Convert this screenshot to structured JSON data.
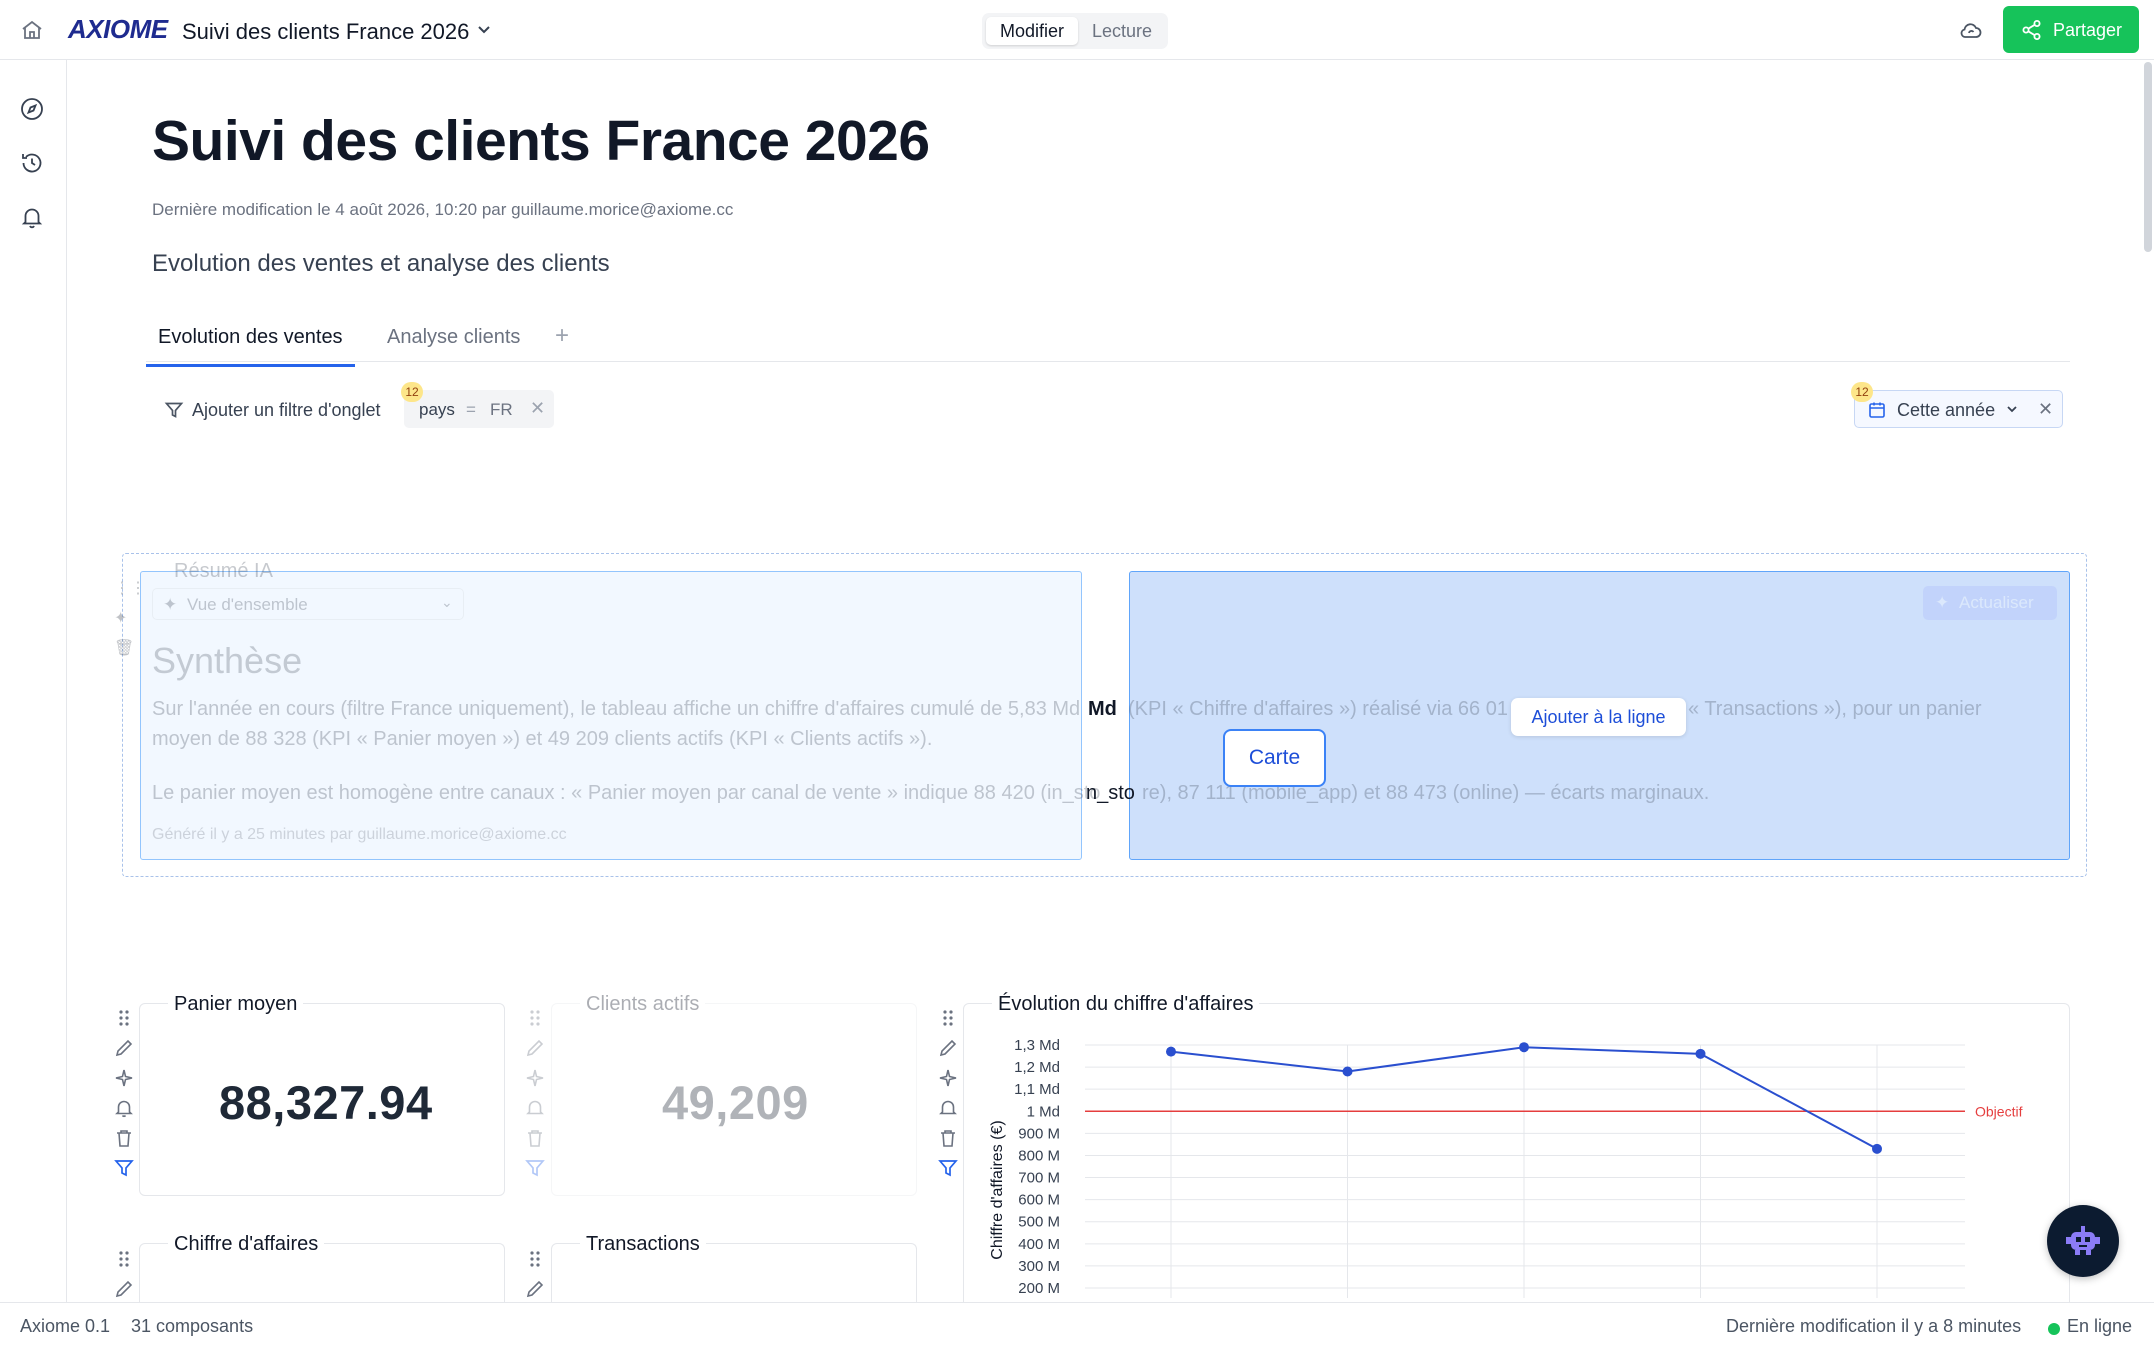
{
  "topbar": {
    "logo": "AXIOME",
    "document_title": "Suivi des clients France 2026",
    "mode_edit": "Modifier",
    "mode_read": "Lecture",
    "share_label": "Partager"
  },
  "page": {
    "title": "Suivi des clients France 2026",
    "meta": "Dernière modification le 4 août 2026, 10:20 par guillaume.morice@axiome.cc",
    "subtitle": "Evolution des ventes et analyse des clients"
  },
  "tabs": [
    {
      "label": "Evolution des ventes",
      "active": true
    },
    {
      "label": "Analyse clients",
      "active": false
    }
  ],
  "tab_add": "+",
  "filters": {
    "add_label": "Ajouter un filtre d'onglet",
    "chip_badge": "12",
    "chip_key": "pays",
    "chip_op": "=",
    "chip_value": "FR",
    "date_badge": "12",
    "date_label": "Cette année"
  },
  "ai_summary": {
    "card_title": "Résumé IA",
    "view_select": "Vue d'ensemble",
    "refresh_label": "Actualiser",
    "heading": "Synthèse",
    "para1_a": "Sur l'année en cours (filtre France uniquement), le tableau affiche un chiffre d'affaires cumulé de 5,83 Md",
    "para1_b": "(KPI « Chiffre d'affaires ») réalisé via 66 01",
    "para1_c": "« Transactions »), pour un panier",
    "para1_line2": "moyen de 88 328 (KPI « Panier moyen ») et 49 209 clients actifs (KPI « Clients actifs »).",
    "para2_a": "Le panier moyen est homogène entre canaux : « Panier moyen par canal de vente » indique 88 420 (in_sto",
    "para2_b": "re), 87 111 (mobile_app) et 88 473 (online) — écarts marginaux.",
    "generated": "Généré il y a 25 minutes par guillaume.morice@axiome.cc",
    "strip_md": "Md",
    "strip_insto": "n_sto",
    "add_to_line": "Ajouter à la ligne",
    "card_button": "Carte"
  },
  "kpis": [
    {
      "title": "Panier moyen",
      "value": "88,327.94"
    },
    {
      "title": "Clients actifs",
      "value": "49,209"
    },
    {
      "title": "Chiffre d'affaires",
      "value": ""
    },
    {
      "title": "Transactions",
      "value": ""
    }
  ],
  "chart_data": {
    "type": "line",
    "title": "Évolution du chiffre d'affaires",
    "ylabel": "Chiffre d'affaires (€)",
    "ytick_labels": [
      "1,3 Md",
      "1,2 Md",
      "1,1 Md",
      "1 Md",
      "900 M",
      "800 M",
      "700 M",
      "600 M",
      "500 M",
      "400 M",
      "300 M",
      "200 M"
    ],
    "ytick_values": [
      1300,
      1200,
      1100,
      1000,
      900,
      800,
      700,
      600,
      500,
      400,
      300,
      200
    ],
    "unit_note": "values in millions €",
    "ylim": [
      200,
      1300
    ],
    "series": [
      {
        "values": [
          1270,
          1180,
          1290,
          1260,
          830
        ],
        "color": "#2a4fcf"
      }
    ],
    "target": {
      "label": "Objectif",
      "value": 1000,
      "color": "#e53e3e"
    },
    "grid": true
  },
  "statusbar": {
    "version": "Axiome 0.1",
    "components": "31 composants",
    "last_modified": "Dernière modification il y a 8 minutes",
    "online": "En ligne"
  },
  "colors": {
    "accent": "#2563eb",
    "share": "#16c35a",
    "brand": "#1e2b8f"
  }
}
